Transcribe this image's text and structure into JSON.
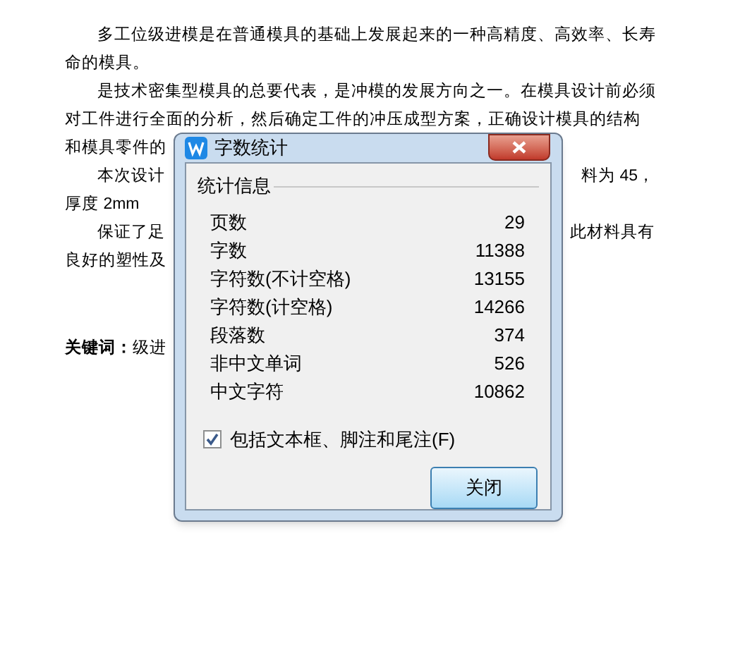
{
  "document": {
    "lines": [
      {
        "left": "多工位级进模是在普通模具的基础上发展起来的一种高精度、高效率、长寿",
        "indent": true
      },
      {
        "left": "命的模具。",
        "indent": false
      },
      {
        "left": "是技术密集型模具的总要代表，是冲模的发展方向之一。在模具设计前必须",
        "indent": true
      },
      {
        "left": "对工件进行全面的分析，然后确定工件的冲压成型方案，正确设计模具的结构",
        "indent": false
      },
      {
        "left": "和模具零件的",
        "indent": false
      },
      {
        "left": "本次设计",
        "right": "料为 45，",
        "indent": true
      },
      {
        "left": "厚度 2mm",
        "indent": false
      },
      {
        "left": "保证了足",
        "right": "此材料具有",
        "indent": true
      },
      {
        "left": "良好的塑性及",
        "indent": false
      }
    ],
    "keywords": {
      "label": "关键词：",
      "text": "级进"
    }
  },
  "dialog": {
    "title": "字数统计",
    "group_title": "统计信息",
    "stats": [
      {
        "label": "页数",
        "value": "29"
      },
      {
        "label": "字数",
        "value": "11388"
      },
      {
        "label": "字符数(不计空格)",
        "value": "13155"
      },
      {
        "label": "字符数(计空格)",
        "value": "14266"
      },
      {
        "label": "段落数",
        "value": "374"
      },
      {
        "label": "非中文单词",
        "value": "526"
      },
      {
        "label": "中文字符",
        "value": "10862"
      }
    ],
    "include_option": {
      "label": "包括文本框、脚注和尾注(F)",
      "checked": true
    },
    "close_button": "关闭"
  }
}
